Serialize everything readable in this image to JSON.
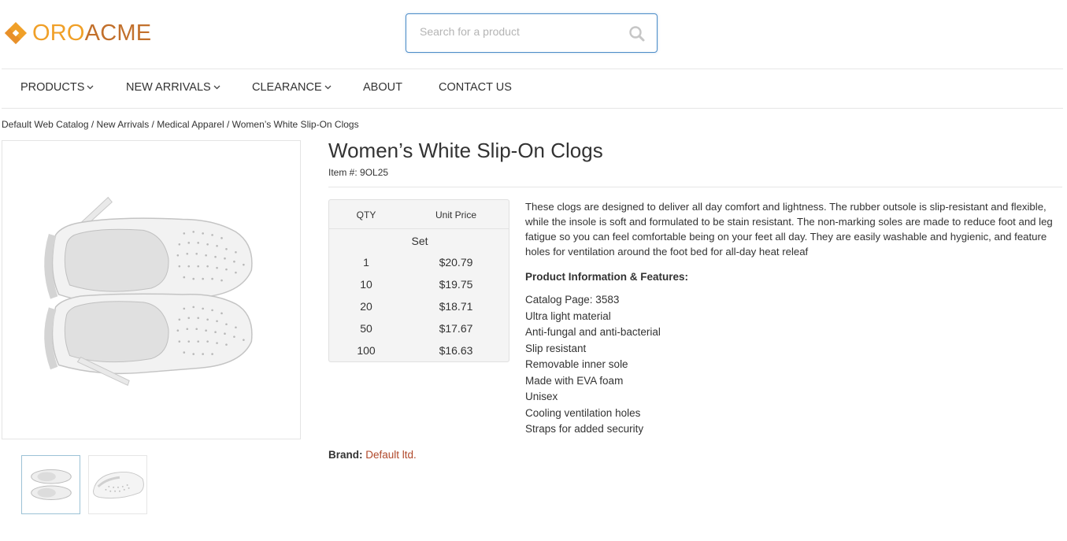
{
  "header": {
    "logo": {
      "part1": "ORO",
      "part2": "ACME"
    },
    "search": {
      "placeholder": "Search for a product",
      "icon": "search-icon"
    }
  },
  "nav": {
    "items": [
      {
        "label": "PRODUCTS",
        "dropdown": true
      },
      {
        "label": "NEW ARRIVALS",
        "dropdown": true
      },
      {
        "label": "CLEARANCE",
        "dropdown": true
      },
      {
        "label": "ABOUT",
        "dropdown": false
      },
      {
        "label": "CONTACT US",
        "dropdown": false
      }
    ]
  },
  "breadcrumb": {
    "text": "Default Web Catalog / New Arrivals / Medical Apparel / Women’s White Slip-On Clogs",
    "items": [
      "Default Web Catalog",
      "New Arrivals",
      "Medical Apparel",
      "Women’s White Slip-On Clogs"
    ]
  },
  "product": {
    "title": "Women’s White Slip-On Clogs",
    "item_number": "Item #: 9OL25",
    "pricing": {
      "qty_header": "QTY",
      "price_header": "Unit Price",
      "unit": "Set",
      "rows": [
        {
          "qty": "1",
          "price": "$20.79"
        },
        {
          "qty": "10",
          "price": "$19.75"
        },
        {
          "qty": "20",
          "price": "$18.71"
        },
        {
          "qty": "50",
          "price": "$17.67"
        },
        {
          "qty": "100",
          "price": "$16.63"
        }
      ]
    },
    "description": "These clogs are designed to deliver all day comfort and lightness. The rubber outsole is slip-resistant and flexible, while the insole is soft and formulated to be stain resistant. The non-marking soles are made to reduce foot and leg fatigue so you can feel comfortable being on your feet all day. They are easily washable and hygienic, and feature holes for ventilation around the foot bed for all-day heat releaf",
    "features_title": "Product Information & Features:",
    "features": [
      "Catalog Page: 3583",
      "Ultra light material",
      "Anti-fungal and anti-bacterial",
      "Slip resistant",
      "Removable inner sole",
      "Made with EVA foam",
      "Unisex",
      "Cooling ventilation holes",
      "Straps for added security"
    ],
    "brand_label": "Brand:",
    "brand_value": "Default ltd."
  },
  "colors": {
    "logo_orange": "#f0a028",
    "logo_brown": "#c2702c",
    "brand_link": "#b0482a",
    "search_border": "#4c8cc8"
  }
}
